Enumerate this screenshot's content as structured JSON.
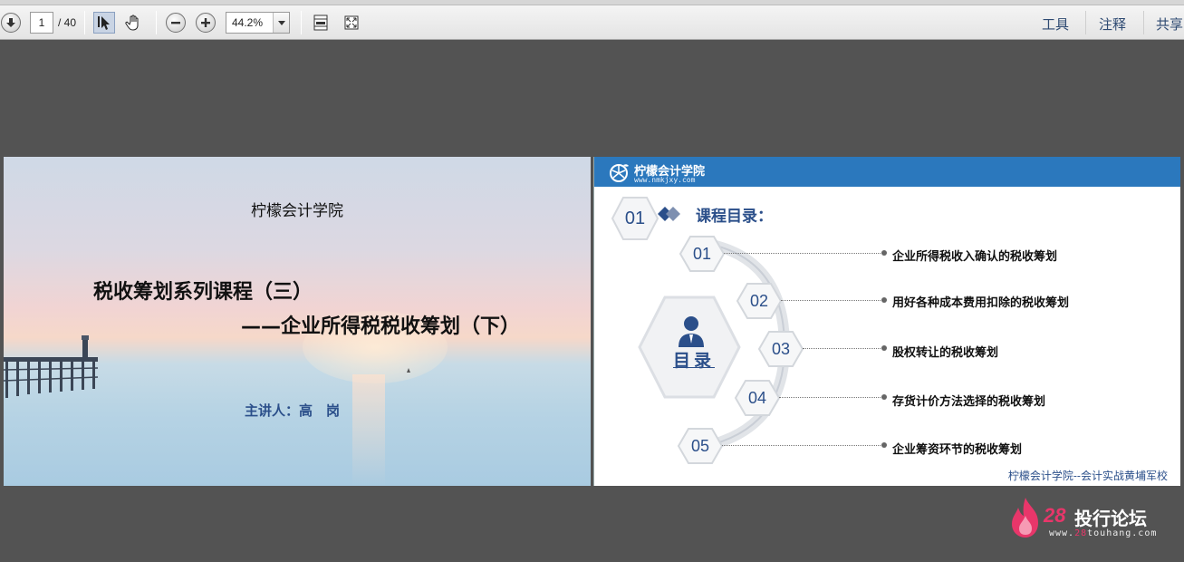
{
  "toolbar": {
    "page_current": "1",
    "page_total": "/ 40",
    "zoom": "44.2%",
    "menu": [
      "工具",
      "注释",
      "共享"
    ]
  },
  "slide1": {
    "school": "柠檬会计学院",
    "title": "税收筹划系列课程（三）",
    "subtitle": "——企业所得税税收筹划（下）",
    "lecturer": "主讲人：高　岗"
  },
  "slide2": {
    "brand": "柠檬会计学院",
    "url": "www.nmkjxy.com",
    "section_num": "01",
    "section_title": "课程目录：",
    "center_label": "目录",
    "items": [
      {
        "num": "01",
        "text": "企业所得税收入确认的税收筹划"
      },
      {
        "num": "02",
        "text": "用好各种成本费用扣除的税收筹划"
      },
      {
        "num": "03",
        "text": "股权转让的税收筹划"
      },
      {
        "num": "04",
        "text": "存货计价方法选择的税收筹划"
      },
      {
        "num": "05",
        "text": "企业筹资环节的税收筹划"
      }
    ],
    "footer": "柠檬会计学院--会计实战黄埔军校"
  },
  "watermark": {
    "num": "28",
    "text": "投行论坛",
    "url_prefix": "www.",
    "url_mid": "28",
    "url_suffix": "touhang.com"
  },
  "colors": {
    "accent": "#2b4f8a",
    "header_blue": "#2b78bd",
    "background": "#535353"
  }
}
